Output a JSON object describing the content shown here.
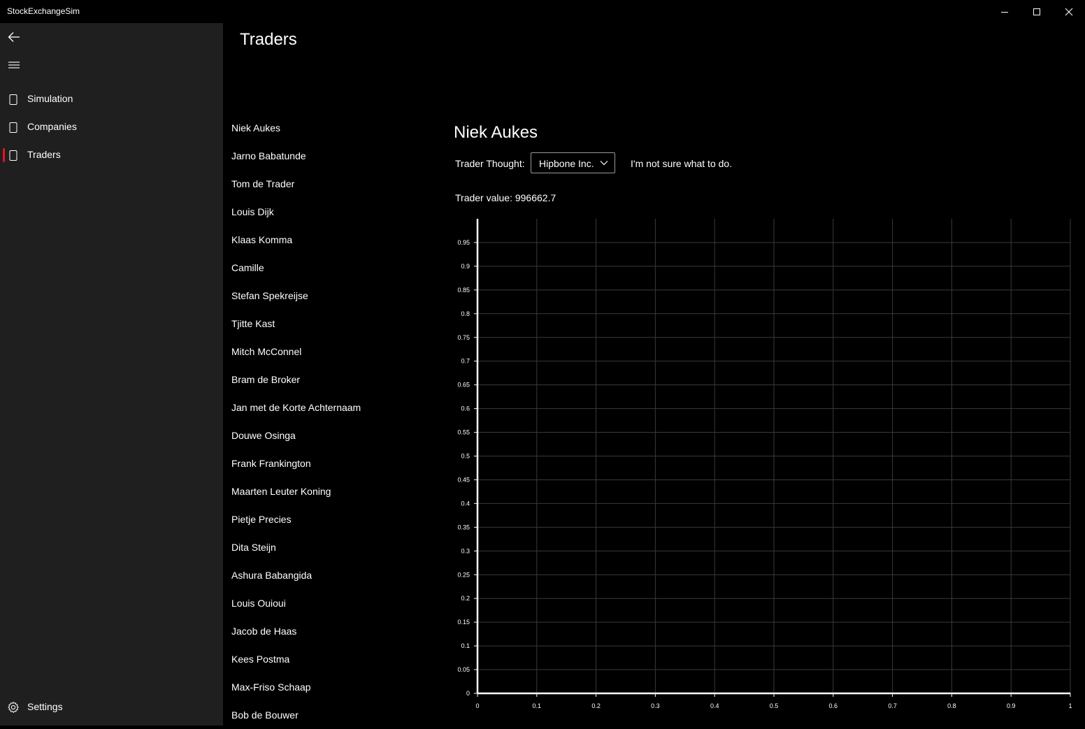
{
  "window": {
    "title": "StockExchangeSim",
    "minimize_icon": "minimize-icon",
    "maximize_icon": "maximize-icon",
    "close_icon": "close-icon"
  },
  "sidebar": {
    "back_icon": "back-arrow-icon",
    "menu_icon": "hamburger-icon",
    "items": [
      {
        "label": "Simulation",
        "icon": "page-icon",
        "selected": false
      },
      {
        "label": "Companies",
        "icon": "page-icon",
        "selected": false
      },
      {
        "label": "Traders",
        "icon": "page-icon",
        "selected": true
      }
    ],
    "settings": {
      "label": "Settings",
      "icon": "gear-icon"
    },
    "selection_color": "#e81123"
  },
  "page": {
    "title": "Traders"
  },
  "traders": [
    "Niek Aukes",
    "Jarno Babatunde",
    "Tom de Trader",
    "Louis Dijk",
    "Klaas Komma",
    "Camille",
    "Stefan Spekreijse",
    "Tjitte Kast",
    "Mitch McConnel",
    "Bram de Broker",
    "Jan met de Korte Achternaam",
    "Douwe Osinga",
    "Frank Frankington",
    "Maarten Leuter Koning",
    "Pietje Precies",
    "Dita Steijn",
    "Ashura Babangida",
    "Louis Ouioui",
    "Jacob de Haas",
    "Kees Postma",
    "Max-Friso Schaap",
    "Bob de Bouwer"
  ],
  "detail": {
    "name": "Niek Aukes",
    "thought_label": "Trader Thought:",
    "company_selected": "Hipbone Inc.",
    "thought_text": "I'm not sure what to do.",
    "value_text": "Trader value: 996662.7"
  },
  "chart_data": {
    "type": "line",
    "series": [],
    "xlim": [
      0,
      1
    ],
    "ylim": [
      0,
      1
    ],
    "x_ticks": [
      "0",
      "0.1",
      "0.2",
      "0.3",
      "0.4",
      "0.5",
      "0.6",
      "0.7",
      "0.8",
      "0.9",
      "1"
    ],
    "y_ticks": [
      "0",
      "0.05",
      "0.1",
      "0.15",
      "0.2",
      "0.25",
      "0.3",
      "0.35",
      "0.4",
      "0.45",
      "0.5",
      "0.55",
      "0.6",
      "0.65",
      "0.7",
      "0.75",
      "0.8",
      "0.85",
      "0.9",
      "0.95"
    ],
    "grid": true,
    "title": "",
    "xlabel": "",
    "ylabel": ""
  }
}
